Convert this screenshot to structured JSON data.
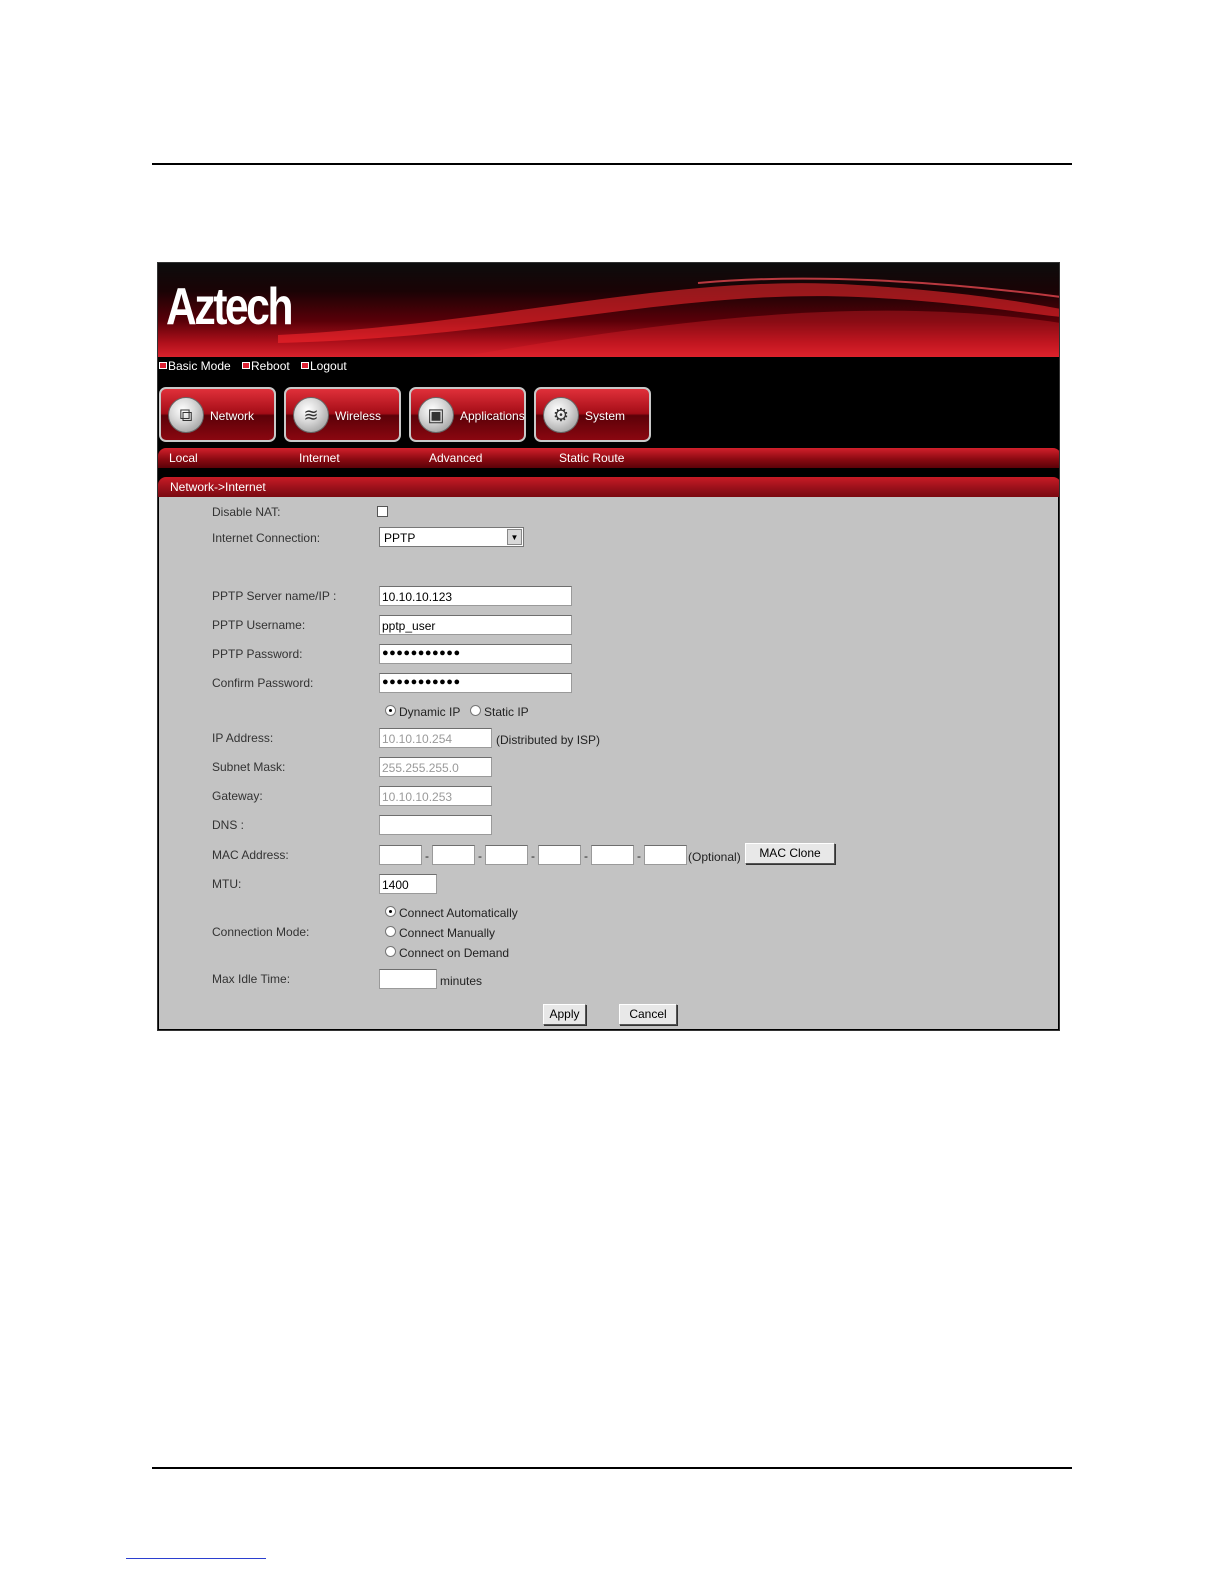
{
  "app": {
    "logo": "Aztech",
    "top_links": [
      "Basic Mode",
      "Reboot",
      "Logout"
    ],
    "nav_buttons": [
      {
        "label": "Network",
        "icon": "network-icon"
      },
      {
        "label": "Wireless",
        "icon": "wireless-icon"
      },
      {
        "label": "Applications",
        "icon": "applications-icon"
      },
      {
        "label": "System",
        "icon": "system-icon"
      }
    ],
    "sub_nav": [
      "Local",
      "Internet",
      "Advanced",
      "Static Route"
    ],
    "breadcrumb": "Network->Internet"
  },
  "form": {
    "disable_nat": {
      "label": "Disable NAT:",
      "checked": false
    },
    "internet_connection": {
      "label": "Internet Connection:",
      "value": "PPTP"
    },
    "pptp_server": {
      "label": "PPTP Server name/IP :",
      "value": "10.10.10.123"
    },
    "pptp_username": {
      "label": "PPTP Username:",
      "value": "pptp_user"
    },
    "pptp_password": {
      "label": "PPTP Password:",
      "value": "●●●●●●●●●●●"
    },
    "confirm_password": {
      "label": "Confirm Password:",
      "value": "●●●●●●●●●●●"
    },
    "ip_mode": {
      "options": [
        "Dynamic IP",
        "Static IP"
      ],
      "selected": "Dynamic IP"
    },
    "ip_address": {
      "label": "IP Address:",
      "value": "10.10.10.254",
      "note": "(Distributed by ISP)"
    },
    "subnet_mask": {
      "label": "Subnet Mask:",
      "value": "255.255.255.0"
    },
    "gateway": {
      "label": "Gateway:",
      "value": "10.10.10.253"
    },
    "dns": {
      "label": "DNS :",
      "value": ""
    },
    "mac_address": {
      "label": "MAC Address:",
      "separator": "-",
      "optional": "(Optional)",
      "clone_button": "MAC Clone"
    },
    "mtu": {
      "label": "MTU:",
      "value": "1400"
    },
    "connection_mode": {
      "label": "Connection Mode:",
      "options": [
        "Connect Automatically",
        "Connect Manually",
        "Connect on Demand"
      ],
      "selected": "Connect Automatically"
    },
    "max_idle": {
      "label": "Max Idle Time:",
      "value": "",
      "unit": "minutes"
    },
    "apply": "Apply",
    "cancel": "Cancel"
  },
  "colors": {
    "brand_red": "#c81b26",
    "panel_gray": "#c3c3c3"
  }
}
